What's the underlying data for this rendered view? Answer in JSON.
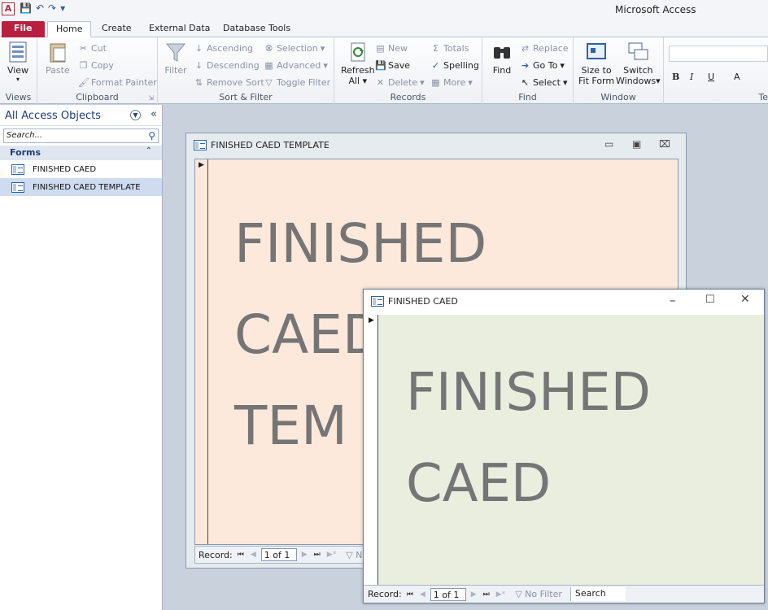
{
  "app": {
    "title": "Microsoft Access",
    "icon_letter": "A"
  },
  "tabs": [
    "File",
    "Home",
    "Create",
    "External Data",
    "Database Tools"
  ],
  "ribbon": {
    "views": {
      "label": "Views",
      "view": "View"
    },
    "clipboard": {
      "label": "Clipboard",
      "paste": "Paste",
      "cut": "Cut",
      "copy": "Copy",
      "format_painter": "Format Painter"
    },
    "sort_filter": {
      "label": "Sort & Filter",
      "filter": "Filter",
      "ascending": "Ascending",
      "descending": "Descending",
      "remove_sort": "Remove Sort",
      "selection": "Selection",
      "advanced": "Advanced",
      "toggle_filter": "Toggle Filter"
    },
    "records": {
      "label": "Records",
      "refresh": "Refresh",
      "refresh_sub": "All",
      "new": "New",
      "save": "Save",
      "delete": "Delete",
      "totals": "Totals",
      "spelling": "Spelling",
      "more": "More"
    },
    "find": {
      "label": "Find",
      "find": "Find",
      "replace": "Replace",
      "goto": "Go To",
      "select": "Select"
    },
    "window": {
      "label": "Window",
      "size_to_fit": "Size to",
      "size_to_fit2": "Fit Form",
      "switch": "Switch",
      "switch2": "Windows"
    },
    "text": {
      "label": "Te",
      "bold": "B",
      "italic": "I",
      "underline": "U",
      "font_color": "A"
    }
  },
  "nav": {
    "header": "All Access Objects",
    "search_placeholder": "Search...",
    "section": "Forms",
    "items": [
      "FINISHED CAED",
      "FINISHED CAED TEMPLATE"
    ]
  },
  "forms": {
    "template": {
      "title": "FINISHED CAED TEMPLATE",
      "lines": [
        "FINISHED",
        "CAED",
        "TEM"
      ],
      "record_label": "Record:",
      "record_pos": "1 of 1",
      "filter": "N"
    },
    "caed": {
      "title": "FINISHED CAED",
      "lines": [
        "FINISHED",
        "CAED"
      ],
      "record_label": "Record:",
      "record_pos": "1 of 1",
      "filter": "No Filter",
      "search": "Search"
    }
  },
  "colors": {
    "file_tab": "#b9203f",
    "template_bg": "#fde9dc",
    "caed_bg": "#e9eedf",
    "big_text": "#757575"
  }
}
